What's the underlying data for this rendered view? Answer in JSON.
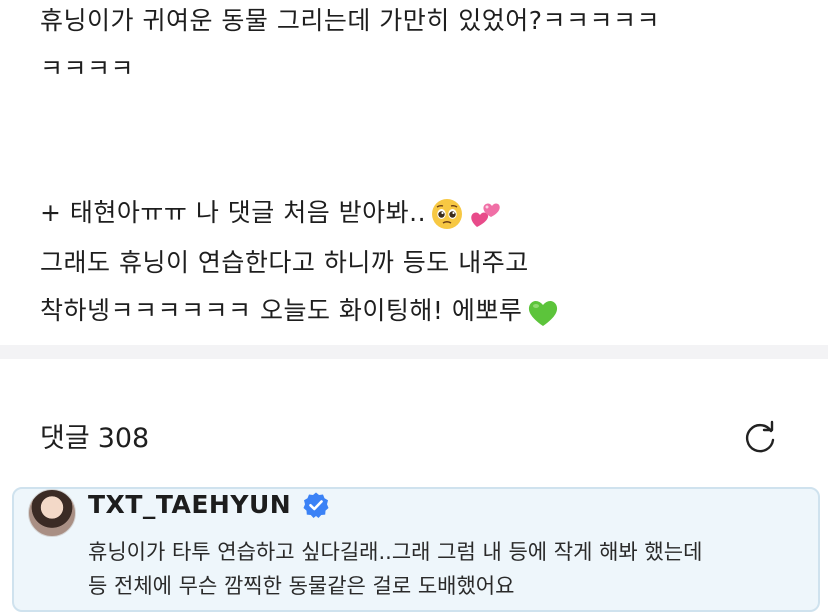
{
  "post": {
    "line1": "휴닝이가 귀여운 동물 그리는데 가만히 있었어?ㅋㅋㅋㅋㅋ",
    "line2": "ㅋㅋㅋㅋ",
    "line3": "+ 태현아ㅠㅠ 나 댓글 처음 받아봐..",
    "line4": "그래도 휴닝이 연습한다고 하니까 등도 내주고",
    "line5": "착하넹ㅋㅋㅋㅋㅋㅋ 오늘도 화이팅해! 에뽀루",
    "emojis": [
      "pleading-face-icon",
      "revolving-hearts-icon",
      "green-heart-icon"
    ]
  },
  "comments": {
    "label": "댓글",
    "count": "308"
  },
  "featured_comment": {
    "author": "TXT_TAEHYUN",
    "verified": true,
    "line1": "휴닝이가 타투 연습하고 싶다길래..그래 그럼 내 등에 작게 해봐 했는데",
    "line2": "등 전체에 무슨 깜찍한 동물같은 걸로 도배했어요"
  },
  "colors": {
    "divider": "#f3f3f5",
    "card_bg": "#eef6fb",
    "card_border": "#cfe2ee",
    "verified": "#3b82f6",
    "green_heart": "#5cc43b"
  }
}
